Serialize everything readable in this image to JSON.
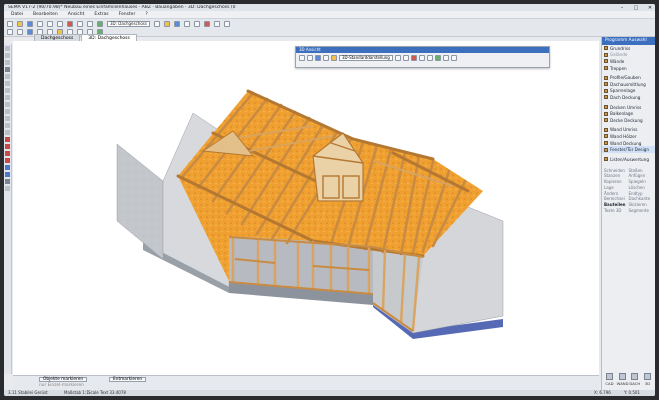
{
  "window": {
    "title": "SEMA V17-2 (90/70.98)* Neubau eines Einfamilienhauses · ABZ · Bauangaben · 3D: Dachgeschoss (0",
    "controls": [
      "–",
      "□",
      "✕"
    ]
  },
  "menu": [
    "Datei",
    "Bearbeiten",
    "Ansicht",
    "Extras",
    "Fenster",
    "?"
  ],
  "toolbar": {
    "view_combo": "3D: Dachgeschoss"
  },
  "tabs": [
    {
      "label": "Dachgeschoss",
      "active": false
    },
    {
      "label": "3D: Dachgeschoss",
      "active": true
    }
  ],
  "float_window": {
    "title": "3D Ansicht",
    "view_combo": "3D-Standarddarstellung"
  },
  "right_panel": {
    "header": "Programm Auswahl",
    "items": [
      {
        "label": "Grundriss",
        "dim": false
      },
      {
        "label": "Gelände",
        "dim": true
      },
      {
        "label": "Wände",
        "dim": false
      },
      {
        "label": "Treppen",
        "dim": false
      },
      {
        "label": "Profile/Gauben",
        "dim": false
      },
      {
        "label": "Dachausmittlung",
        "dim": false
      },
      {
        "label": "Sparrenlage",
        "dim": false
      },
      {
        "label": "Dach Deckung",
        "dim": false
      },
      {
        "label": "Decken Umriss",
        "dim": false
      },
      {
        "label": "Balkenlage",
        "dim": false
      },
      {
        "label": "Decke Deckung",
        "dim": false
      },
      {
        "label": "Wand Umriss",
        "dim": false
      },
      {
        "label": "Wand Hölzer",
        "dim": false
      },
      {
        "label": "Wand Deckung",
        "dim": false
      },
      {
        "label": "Fenster/Tür Design",
        "dim": false
      },
      {
        "label": "Listen/Auswertung",
        "dim": false
      }
    ],
    "grid": [
      [
        "Schneiden",
        "Stoßen"
      ],
      [
        "Stanzen",
        "Anfügen"
      ],
      [
        "Kopieren",
        "Spiegeln"
      ],
      [
        "Lage",
        "Löschen"
      ],
      [
        "Ändern",
        "Endtyp"
      ],
      [
        "Bereichsei",
        "Dachkante"
      ],
      [
        "Bauteilen",
        "Skizieren"
      ],
      [
        "Texte 3D",
        "Segmente"
      ]
    ],
    "bottom_buttons": [
      "CAD",
      "WAND",
      "DACH",
      "3D"
    ]
  },
  "bottom_panel": {
    "mark_button": "Objekte markieren",
    "end_button": "Entmarkieren",
    "checkbox_label": "nur Einzel-markieren"
  },
  "statusbar": {
    "left": "3.11 Stabilei Gerüst",
    "scale": "Maßstab 1:1",
    "scale_text": "Scale Text 33.4078",
    "x": "X: 6.796",
    "y": "Y: 0.501"
  },
  "colors": {
    "wood": "#d9a460",
    "insulation": "#f0a030",
    "wall": "#c3c6ca",
    "accent": "#3d6fbf"
  }
}
